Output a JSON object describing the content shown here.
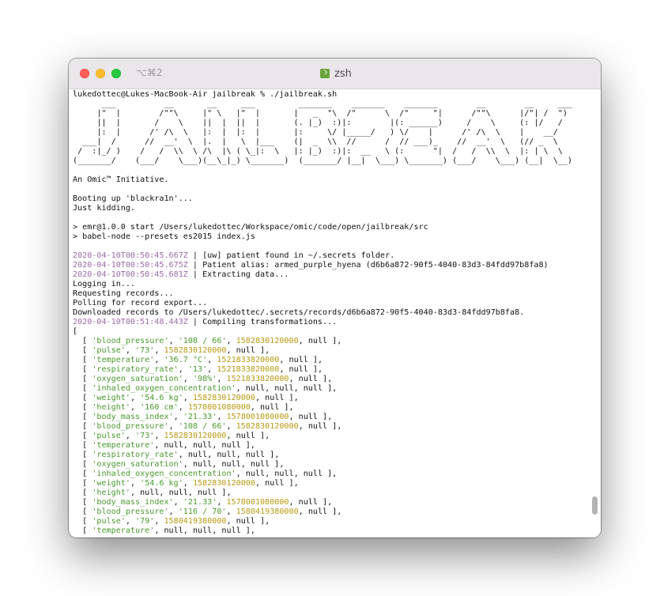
{
  "window": {
    "shortcut": "⌥⌘2",
    "title": "zsh",
    "title_icon": "terminal-icon"
  },
  "terminal": {
    "prompt_line": "lukedottec@Lukes-MacBook-Air jailbreak % ./jailbreak.sh",
    "banner": [
      "      ___          __       __     ___         _______    _______    _______        __        __     ___",
      "     |\"  |        /\"\"\\     |\" \\   |\"  |       |   _  \"\\  /\"      \\  /\"     \"|      /\"\"\\      |/\"| /  \")",
      "     ||  |       /    \\    ||  |  ||  |       (. |_)  :)|:        |(: ______)     /    \\     (: |/   /",
      "     |:  |      /' /\\  \\   |:  |  |:  |       |:     \\/ |_____/   ) \\/    |      /' /\\  \\    |    __/",
      "  ___|  /      //  __'  \\  |.  |   \\  |___    (|  _  \\\\  //      /  // ___)_    //  __'  \\   (// _  \\",
      " /  :|_/ )    /   /  \\\\  \\ /\\  |\\ ( \\_|:  \\   |: |_)  :)|:  __   \\ (:      \"|  /   /  \\\\  \\  |: | \\  \\",
      "(_______/    (___/    \\___)(__\\_|_) \\_______)  (_______/ |__|  \\___) \\_______) (___/    \\___) (__|  \\__)"
    ],
    "initiative": "An Omic™ Initiative.",
    "booting": "Booting up 'blackra1n'...",
    "kidding": "Just kidding.",
    "npm_start": "> emr@1.0.0 start /Users/lukedottec/Workspace/omic/code/open/jailbreak/src",
    "npm_cmd": "> babel-node --presets es2015 index.js",
    "log": [
      {
        "ts": "2020-04-10T00:50:45.667Z",
        "msg": " | [uw] patient found in ~/.secrets folder."
      },
      {
        "ts": "2020-04-10T00:50:45.675Z",
        "msg": " | Patient alias: armed_purple_hyena (d6b6a872-90f5-4040-83d3-84fdd97b8fa8)"
      },
      {
        "ts": "2020-04-10T00:50:45.681Z",
        "msg": " | Extracting data..."
      }
    ],
    "status": [
      "Logging in...",
      "Requesting records...",
      "Polling for record export...",
      "Downloaded records to /Users/lukedottec/.secrets/records/d6b6a872-90f5-4040-83d3-84fdd97b8fa8."
    ],
    "compile": {
      "ts": "2020-04-10T00:51:48.443Z",
      "msg": " | Compiling transformations..."
    },
    "open_bracket": "[",
    "records": [
      [
        "'blood_pressure'",
        "'108 / 66'",
        "1582830120000",
        "null"
      ],
      [
        "'pulse'",
        "'73'",
        "1582830120000",
        "null"
      ],
      [
        "'temperature'",
        "'36.7 °C'",
        "1521833820000",
        "null"
      ],
      [
        "'respiratory_rate'",
        "'13'",
        "1521833820000",
        "null"
      ],
      [
        "'oxygen_saturation'",
        "'98%'",
        "1521833820000",
        "null"
      ],
      [
        "'inhaled_oxygen_concentration'",
        "null",
        "null",
        "null"
      ],
      [
        "'weight'",
        "'54.6 kg'",
        "1582830120000",
        "null"
      ],
      [
        "'height'",
        "'160 cm'",
        "1578001080000",
        "null"
      ],
      [
        "'body_mass_index'",
        "'21.33'",
        "1578001080000",
        "null"
      ],
      [
        "'blood_pressure'",
        "'108 / 66'",
        "1582830120000",
        "null"
      ],
      [
        "'pulse'",
        "'73'",
        "1582830120000",
        "null"
      ],
      [
        "'temperature'",
        "null",
        "null",
        "null"
      ],
      [
        "'respiratory_rate'",
        "null",
        "null",
        "null"
      ],
      [
        "'oxygen_saturation'",
        "null",
        "null",
        "null"
      ],
      [
        "'inhaled_oxygen_concentration'",
        "null",
        "null",
        "null"
      ],
      [
        "'weight'",
        "'54.6 kg'",
        "1582830120000",
        "null"
      ],
      [
        "'height'",
        "null",
        "null",
        "null"
      ],
      [
        "'body_mass_index'",
        "'21.33'",
        "1578001080000",
        "null"
      ],
      [
        "'blood_pressure'",
        "'116 / 70'",
        "1580419380000",
        "null"
      ],
      [
        "'pulse'",
        "'79'",
        "1580419380000",
        "null"
      ],
      [
        "'temperature'",
        "null",
        "null",
        "null"
      ]
    ]
  },
  "colors": {
    "timestamp": "#9b6aa8",
    "string": "#4a9a2f",
    "number": "#b89a11"
  }
}
